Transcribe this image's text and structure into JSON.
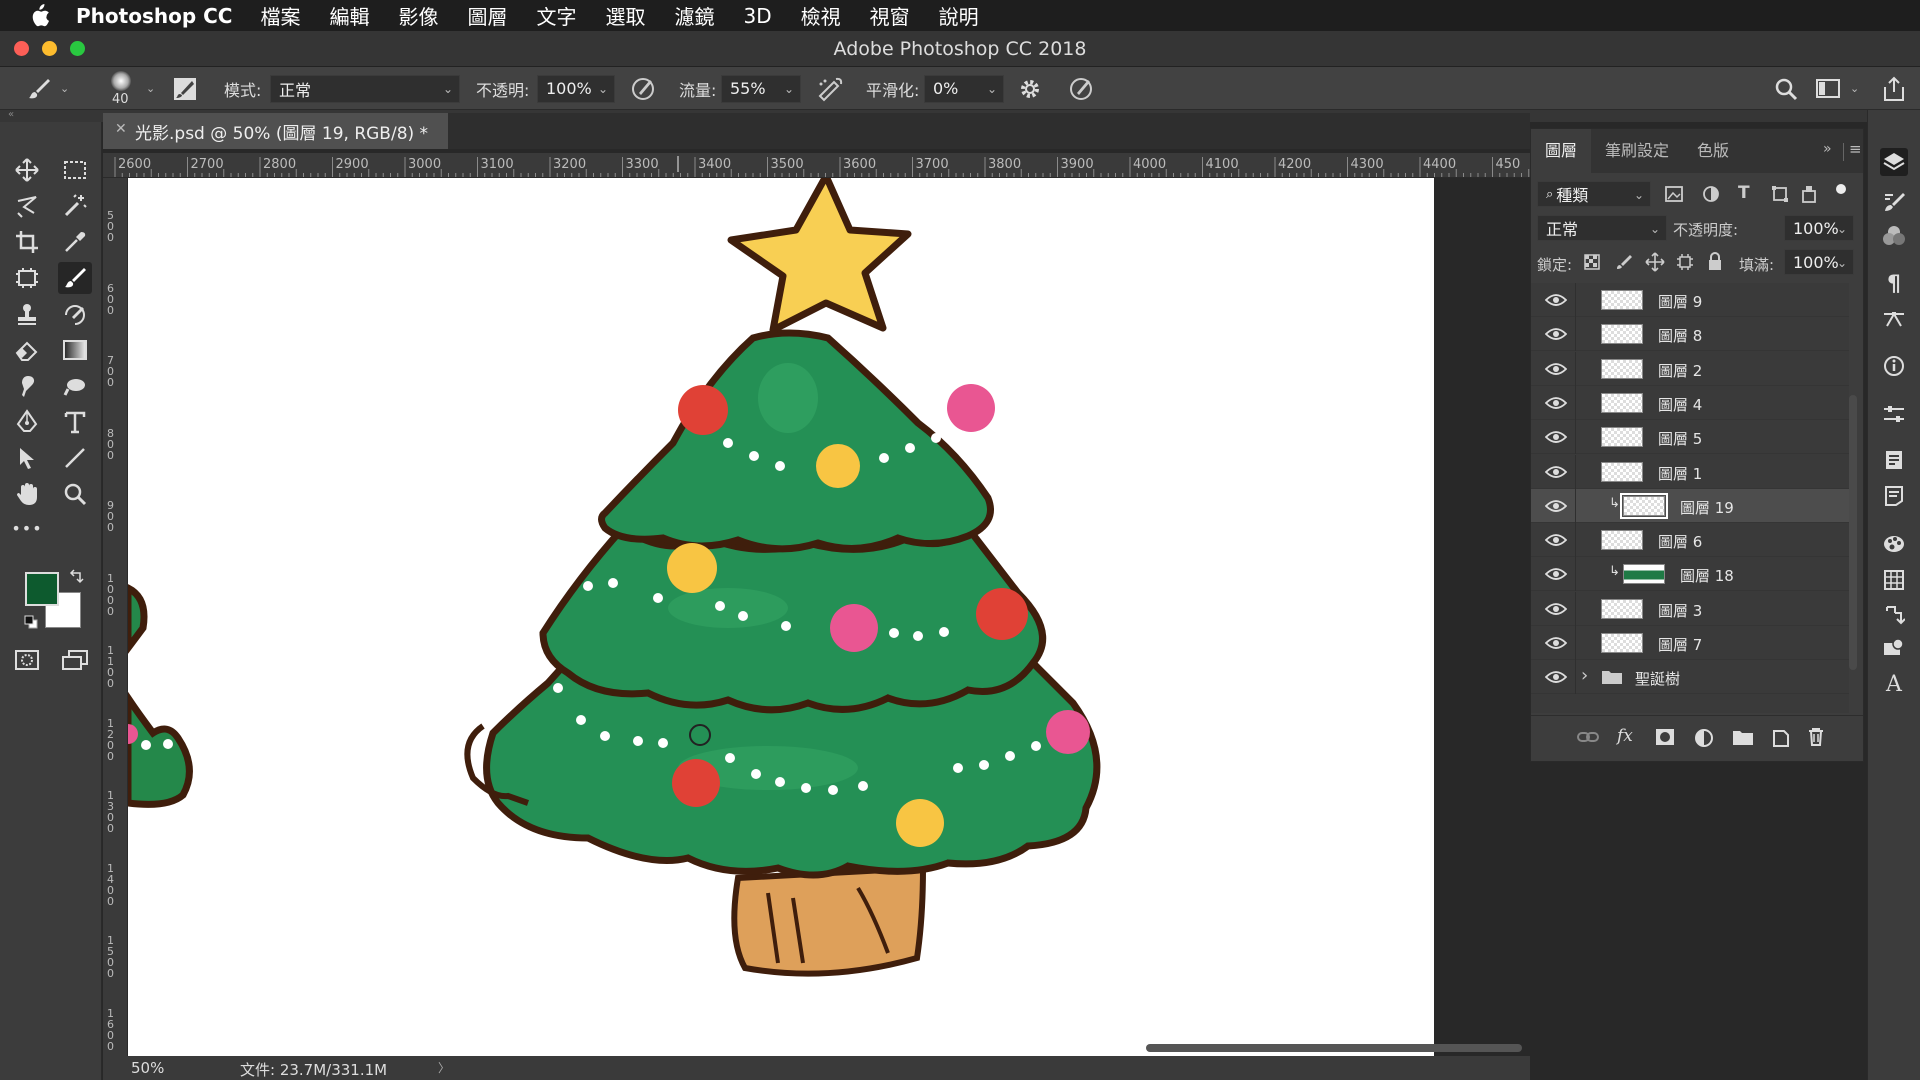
{
  "menubar": {
    "app_name": "Photoshop CC",
    "items": [
      "檔案",
      "編輯",
      "影像",
      "圖層",
      "文字",
      "選取",
      "濾鏡",
      "3D",
      "檢視",
      "視窗",
      "說明"
    ]
  },
  "window": {
    "title": "Adobe Photoshop CC 2018"
  },
  "options": {
    "brush_size": "40",
    "mode_label": "模式:",
    "mode_value": "正常",
    "opacity_label": "不透明:",
    "opacity_value": "100%",
    "flow_label": "流量:",
    "flow_value": "55%",
    "smoothing_label": "平滑化:",
    "smoothing_value": "0%"
  },
  "document": {
    "tab_label": "光影.psd @ 50% (圖層 19, RGB/8) *",
    "zoom": "50%",
    "file_info": "文件: 23.7M/331.1M",
    "status_arrow": "〉"
  },
  "rulers": {
    "h_ticks": [
      "2600",
      "2700",
      "2800",
      "2900",
      "3000",
      "3100",
      "3200",
      "3300",
      "3400",
      "3500",
      "3600",
      "3700",
      "3800",
      "3900",
      "4000",
      "4100",
      "4200",
      "4300",
      "4400",
      "450"
    ],
    "v_ticks": [
      "5\n0\n0",
      "6\n0\n0",
      "7\n0\n0",
      "8\n0\n0",
      "9\n0\n0",
      "1\n0\n0\n0",
      "1\n1\n0\n0",
      "1\n2\n0\n0",
      "1\n3\n0\n0",
      "1\n4\n0\n0",
      "1\n5\n0\n0",
      "1\n6\n0\n0"
    ]
  },
  "colors": {
    "foreground": "#0d5a2e",
    "background": "#ffffff",
    "accent": "#ffffff"
  },
  "layers_panel": {
    "tabs": [
      "圖層",
      "筆刷設定",
      "色版"
    ],
    "filter_label": "種類",
    "blend_mode": "正常",
    "opacity_label": "不透明度:",
    "opacity_value": "100%",
    "lock_label": "鎖定:",
    "fill_label": "填滿:",
    "fill_value": "100%",
    "layers": [
      {
        "name": "圖層 9"
      },
      {
        "name": "圖層 8"
      },
      {
        "name": "圖層 2"
      },
      {
        "name": "圖層 4"
      },
      {
        "name": "圖層 5"
      },
      {
        "name": "圖層 1"
      },
      {
        "name": "圖層 19",
        "selected": true,
        "clipped": true
      },
      {
        "name": "圖層 6"
      },
      {
        "name": "圖層 18",
        "clipped": true
      },
      {
        "name": "圖層 3"
      },
      {
        "name": "圖層 7"
      },
      {
        "name": "聖誕樹",
        "group": true
      }
    ],
    "footer_icons": [
      "link-icon",
      "fx-icon",
      "mask-icon",
      "adjustment-icon",
      "folder-icon",
      "new-layer-icon",
      "trash-icon"
    ]
  }
}
